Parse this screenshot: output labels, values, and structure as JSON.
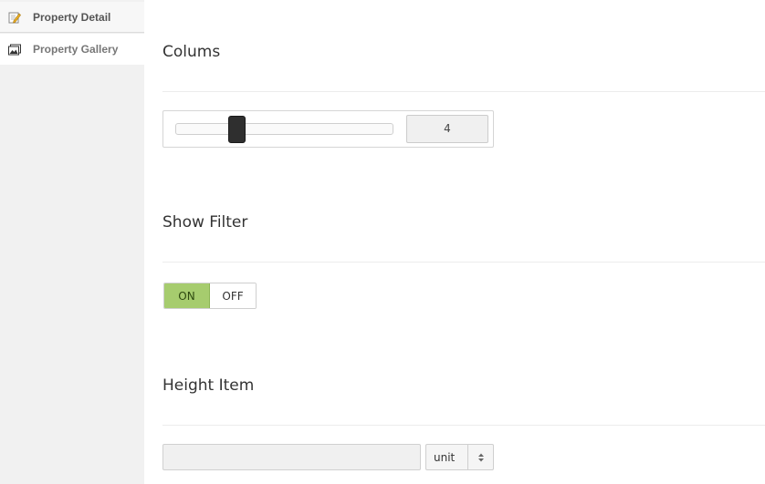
{
  "sidebar": {
    "items": [
      {
        "label": "Property Detail",
        "icon": "edit-icon",
        "active": true
      },
      {
        "label": "Property Gallery",
        "icon": "gallery-icon",
        "active": false
      }
    ]
  },
  "sections": {
    "columns": {
      "title": "Colums",
      "value": "4"
    },
    "filter": {
      "title": "Show Filter",
      "on_label": "ON",
      "off_label": "OFF",
      "state": "ON"
    },
    "height": {
      "title": "Height Item",
      "value": "",
      "unit_label": "unit"
    }
  },
  "colors": {
    "toggle_on": "#a6cc6e",
    "sidebar_bg": "#f1f1f1",
    "slider_handle": "#2f2f2f"
  }
}
